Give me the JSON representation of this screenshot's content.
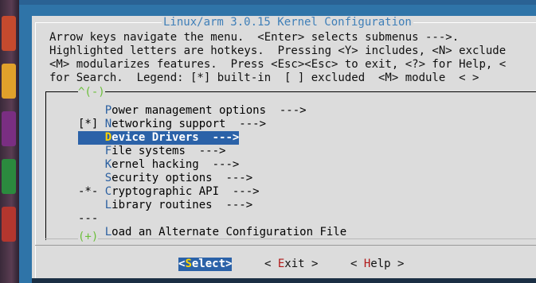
{
  "window": {
    "screen_title": "Linux/arm 3.0.15 Kernel Configuration"
  },
  "help_lines": [
    "Arrow keys navigate the menu.  <Enter> selects submenus --->.",
    "Highlighted letters are hotkeys.  Pressing <Y> includes, <N> exclude",
    "<M> modularizes features.  Press <Esc><Esc> to exit, <?> for Help, <",
    "for Search.  Legend: [*] built-in  [ ] excluded  <M> module  < >"
  ],
  "scroll": {
    "more_up": "^(-)",
    "more_down": "(+)"
  },
  "menu_items": [
    {
      "prefix": "    ",
      "hot": "P",
      "rest": "ower management options  --->",
      "selected": false
    },
    {
      "prefix": "[*] ",
      "hot": "N",
      "rest": "etworking support  --->",
      "selected": false
    },
    {
      "prefix": "    ",
      "hot": "D",
      "rest": "evice Drivers  --->",
      "selected": true
    },
    {
      "prefix": "    ",
      "hot": "F",
      "rest": "ile systems  --->",
      "selected": false
    },
    {
      "prefix": "    ",
      "hot": "K",
      "rest": "ernel hacking  --->",
      "selected": false
    },
    {
      "prefix": "    ",
      "hot": "S",
      "rest": "ecurity options  --->",
      "selected": false
    },
    {
      "prefix": "-*- ",
      "hot": "C",
      "rest": "ryptographic API  --->",
      "selected": false
    },
    {
      "prefix": "    ",
      "hot": "L",
      "rest": "ibrary routines  --->",
      "selected": false
    },
    {
      "prefix": "---",
      "hot": "",
      "rest": "",
      "selected": false
    },
    {
      "prefix": "    ",
      "hot": "L",
      "rest": "oad an Alternate Configuration File",
      "selected": false
    }
  ],
  "buttons": [
    {
      "pre": "<",
      "hot": "S",
      "rest": "elect>",
      "selected": true
    },
    {
      "pre": "< ",
      "hot": "E",
      "rest": "xit >",
      "selected": false
    },
    {
      "pre": "< ",
      "hot": "H",
      "rest": "elp >",
      "selected": false
    }
  ]
}
